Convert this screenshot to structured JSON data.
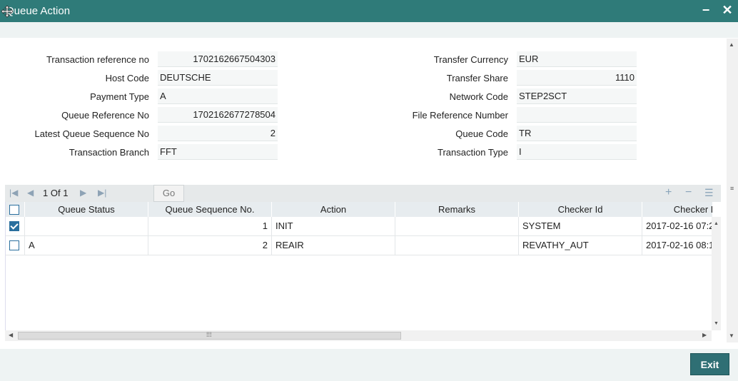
{
  "window": {
    "title": "Queue Action",
    "minimize": "−",
    "close": "✕"
  },
  "form": {
    "left": [
      {
        "label": "Transaction reference no",
        "value": "1702162667504303",
        "align": "right"
      },
      {
        "label": "Host Code",
        "value": "DEUTSCHE",
        "align": "left"
      },
      {
        "label": "Payment Type",
        "value": "A",
        "align": "left"
      },
      {
        "label": "Queue Reference No",
        "value": "1702162677278504",
        "align": "right"
      },
      {
        "label": "Latest Queue Sequence No",
        "value": "2",
        "align": "right"
      },
      {
        "label": "Transaction Branch",
        "value": "FFT",
        "align": "left"
      }
    ],
    "right": [
      {
        "label": "Transfer Currency",
        "value": "EUR",
        "align": "left"
      },
      {
        "label": "Transfer Share",
        "value": "1110",
        "align": "right"
      },
      {
        "label": "Network Code",
        "value": "STEP2SCT",
        "align": "left"
      },
      {
        "label": "File Reference Number",
        "value": "",
        "align": "left"
      },
      {
        "label": "Queue Code",
        "value": "TR",
        "align": "left"
      },
      {
        "label": "Transaction Type",
        "value": "I",
        "align": "left"
      }
    ]
  },
  "grid": {
    "pager": {
      "current": "1",
      "of_label": "Of",
      "total": "1",
      "go_label": "Go"
    },
    "columns": [
      "Queue Status",
      "Queue Sequence No.",
      "Action",
      "Remarks",
      "Checker Id",
      "Checker Date"
    ],
    "rows": [
      {
        "checked": true,
        "cells": [
          "",
          "1",
          "INIT",
          "",
          "SYSTEM",
          "2017-02-16 07:2"
        ]
      },
      {
        "checked": false,
        "cells": [
          "A",
          "2",
          "REAIR",
          "",
          "REVATHY_AUT",
          "2017-02-16 08:1"
        ]
      }
    ]
  },
  "footer": {
    "exit_label": "Exit"
  },
  "colors": {
    "titlebar": "#2f7b79",
    "button": "#2f6f74",
    "checkbox": "#2a6f9e"
  }
}
